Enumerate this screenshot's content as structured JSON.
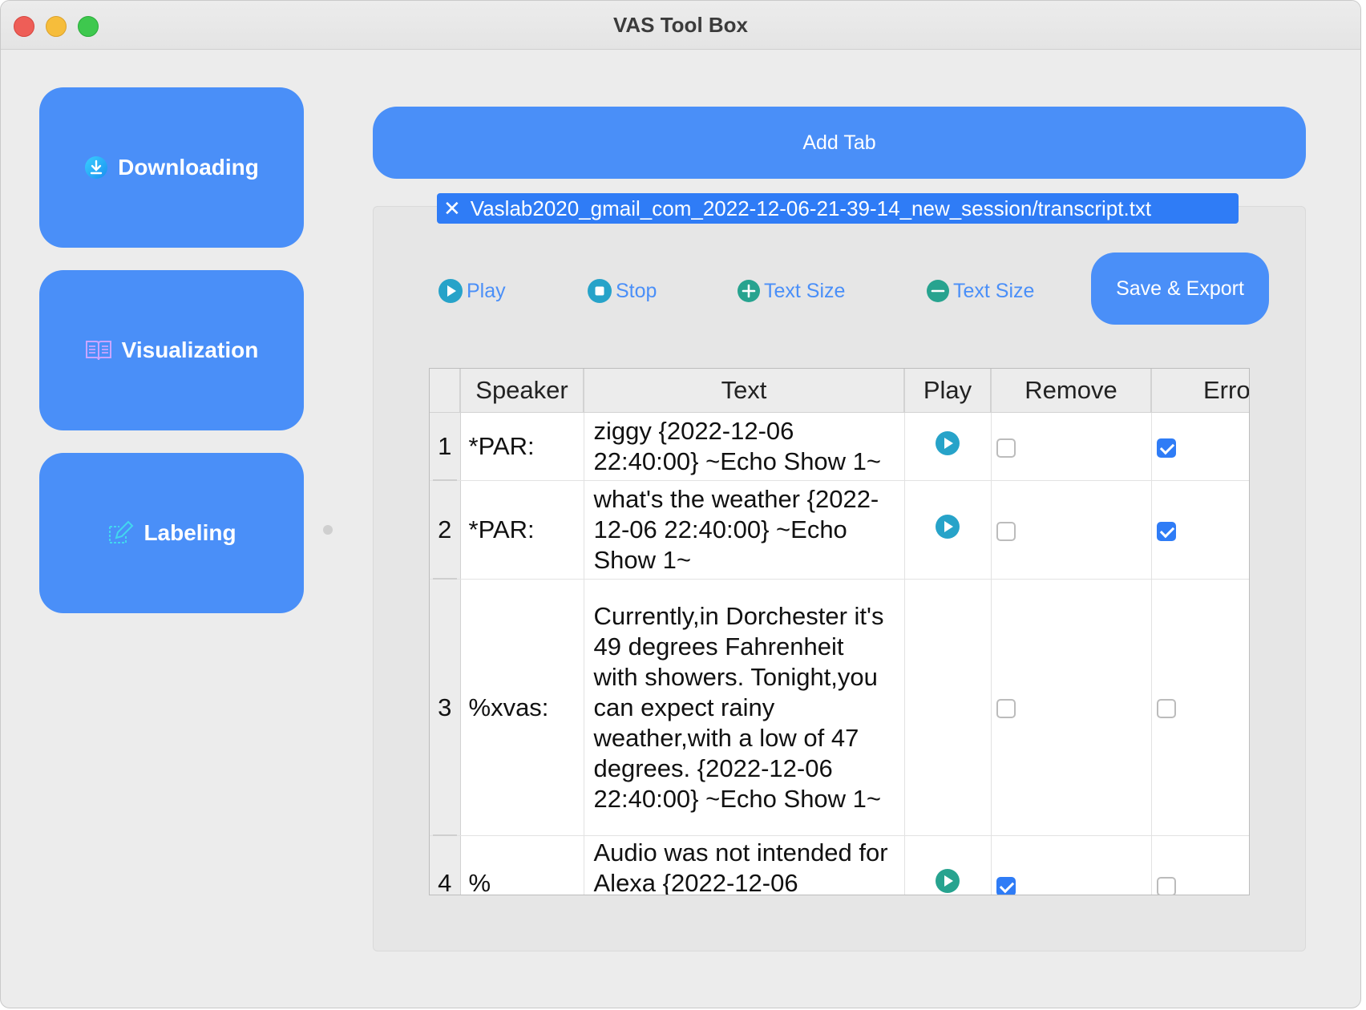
{
  "window": {
    "title": "VAS Tool Box"
  },
  "sidebar": {
    "items": [
      {
        "label": "Downloading",
        "icon": "download-icon"
      },
      {
        "label": "Visualization",
        "icon": "book-icon"
      },
      {
        "label": "Labeling",
        "icon": "edit-icon"
      }
    ]
  },
  "add_tab": {
    "label": "Add Tab"
  },
  "tab": {
    "label": "Vaslab2020_gmail_com_2022-12-06-21-39-14_new_session/transcript.txt",
    "close": "✕"
  },
  "toolbar": {
    "play": "Play",
    "stop": "Stop",
    "text_size_plus": "Text Size",
    "text_size_minus": "Text Size",
    "save_export": "Save & Export"
  },
  "table": {
    "columns": [
      "",
      "Speaker",
      "Text",
      "Play",
      "Remove",
      "Error"
    ],
    "rows": [
      {
        "num": "1",
        "speaker": "*PAR:",
        "text": "ziggy {2022-12-06 22:40:00} ~Echo Show 1~",
        "play": true,
        "remove": false,
        "error": true
      },
      {
        "num": "2",
        "speaker": "*PAR:",
        "text": "what's the weather {2022-12-06 22:40:00} ~Echo Show 1~",
        "play": true,
        "remove": false,
        "error": true
      },
      {
        "num": "3",
        "speaker": "%xvas:",
        "text": "Currently,in Dorchester it's 49 degrees Fahrenheit with showers. Tonight,you can expect rainy weather,with a low of 47 degrees. {2022-12-06 22:40:00} ~Echo Show 1~",
        "play": false,
        "remove": false,
        "error": false
      },
      {
        "num": "4",
        "speaker": "%",
        "text": "Audio was not intended for Alexa {2022-12-06",
        "play": true,
        "remove": true,
        "error": false
      }
    ]
  },
  "colors": {
    "accent": "#4a8ff8",
    "tab": "#2f7cf6",
    "play_icon": "#27a3c9"
  }
}
